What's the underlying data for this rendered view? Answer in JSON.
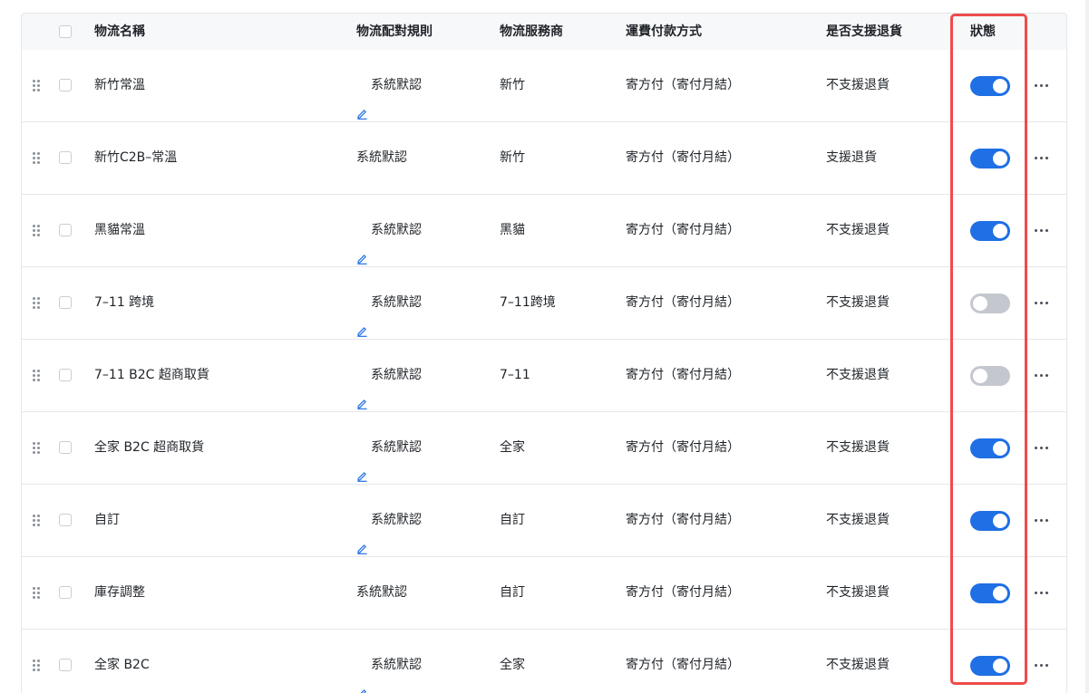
{
  "table": {
    "columns": {
      "name": "物流名稱",
      "rule": "物流配對規則",
      "provider": "物流服務商",
      "payment": "運費付款方式",
      "returns": "是否支援退貨",
      "status": "狀態"
    },
    "rows": [
      {
        "name": "新竹常溫",
        "rule": "系統默認",
        "rule_editable": true,
        "provider": "新竹",
        "payment": "寄方付（寄付月結）",
        "returns": "不支援退貨",
        "status": "on"
      },
      {
        "name": "新竹C2B–常溫",
        "rule": "系統默認",
        "rule_editable": false,
        "provider": "新竹",
        "payment": "寄方付（寄付月結）",
        "returns": "支援退貨",
        "status": "on"
      },
      {
        "name": "黑貓常溫",
        "rule": "系統默認",
        "rule_editable": true,
        "provider": "黑貓",
        "payment": "寄方付（寄付月結）",
        "returns": "不支援退貨",
        "status": "on"
      },
      {
        "name": "7–11 跨境",
        "rule": "系統默認",
        "rule_editable": true,
        "provider": "7–11跨境",
        "payment": "寄方付（寄付月結）",
        "returns": "不支援退貨",
        "status": "off"
      },
      {
        "name": "7–11 B2C 超商取貨",
        "rule": "系統默認",
        "rule_editable": true,
        "provider": "7–11",
        "payment": "寄方付（寄付月結）",
        "returns": "不支援退貨",
        "status": "off"
      },
      {
        "name": "全家 B2C 超商取貨",
        "rule": "系統默認",
        "rule_editable": true,
        "provider": "全家",
        "payment": "寄方付（寄付月結）",
        "returns": "不支援退貨",
        "status": "on"
      },
      {
        "name": "自訂",
        "rule": "系統默認",
        "rule_editable": true,
        "provider": "自訂",
        "payment": "寄方付（寄付月結）",
        "returns": "不支援退貨",
        "status": "on"
      },
      {
        "name": "庫存調整",
        "rule": "系統默認",
        "rule_editable": false,
        "provider": "自訂",
        "payment": "寄方付（寄付月結）",
        "returns": "不支援退貨",
        "status": "on"
      },
      {
        "name": "全家 B2C",
        "rule": "系統默認",
        "rule_editable": true,
        "provider": "全家",
        "payment": "寄方付（寄付月結）",
        "returns": "不支援退貨",
        "status": "on"
      }
    ]
  },
  "icons": {
    "drag": "drag-handle-icon",
    "edit": "edit-icon",
    "more": "more-horizontal-icon"
  },
  "colors": {
    "toggle_on": "#1f6fe5",
    "toggle_off": "#c4c8ce",
    "highlight": "#ef4b4b",
    "edit_icon": "#1f6fe5"
  }
}
